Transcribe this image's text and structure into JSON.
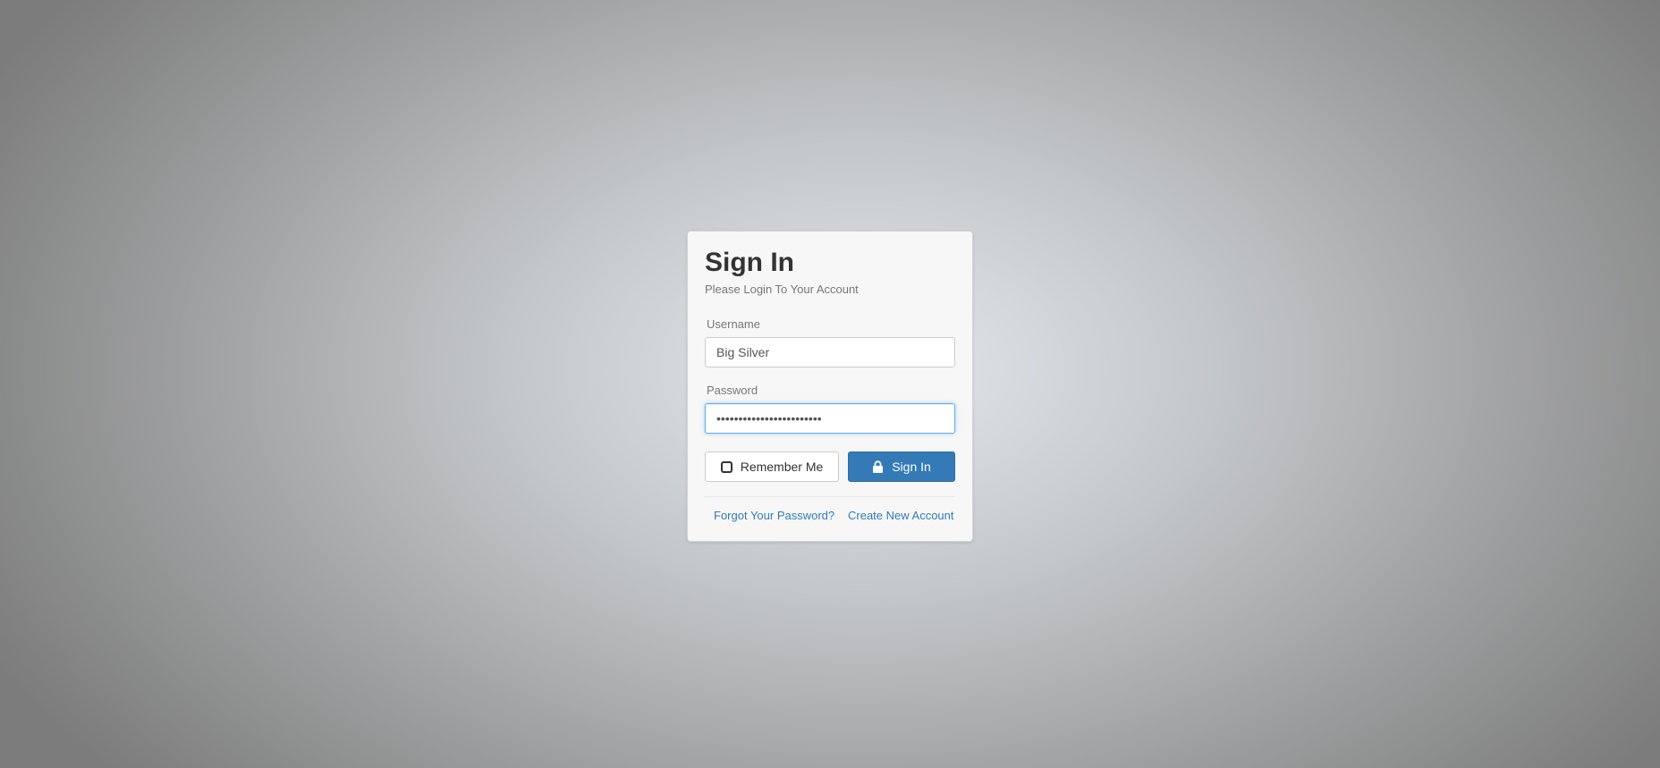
{
  "login": {
    "title": "Sign In",
    "subtitle": "Please Login To Your Account",
    "username": {
      "label": "Username",
      "value": "Big Silver"
    },
    "password": {
      "label": "Password",
      "value": "••••••••••••••••••••••••"
    },
    "remember_label": "Remember Me",
    "remember_checked": false,
    "signin_label": "Sign In",
    "forgot_link": "Forgot Your Password?",
    "create_link": "Create New Account"
  },
  "icons": {
    "remember": "checkbox-icon",
    "signin": "lock-icon"
  },
  "colors": {
    "primary": "#337ab7",
    "focus": "#66afe9",
    "text": "#333333",
    "muted": "#777777"
  }
}
